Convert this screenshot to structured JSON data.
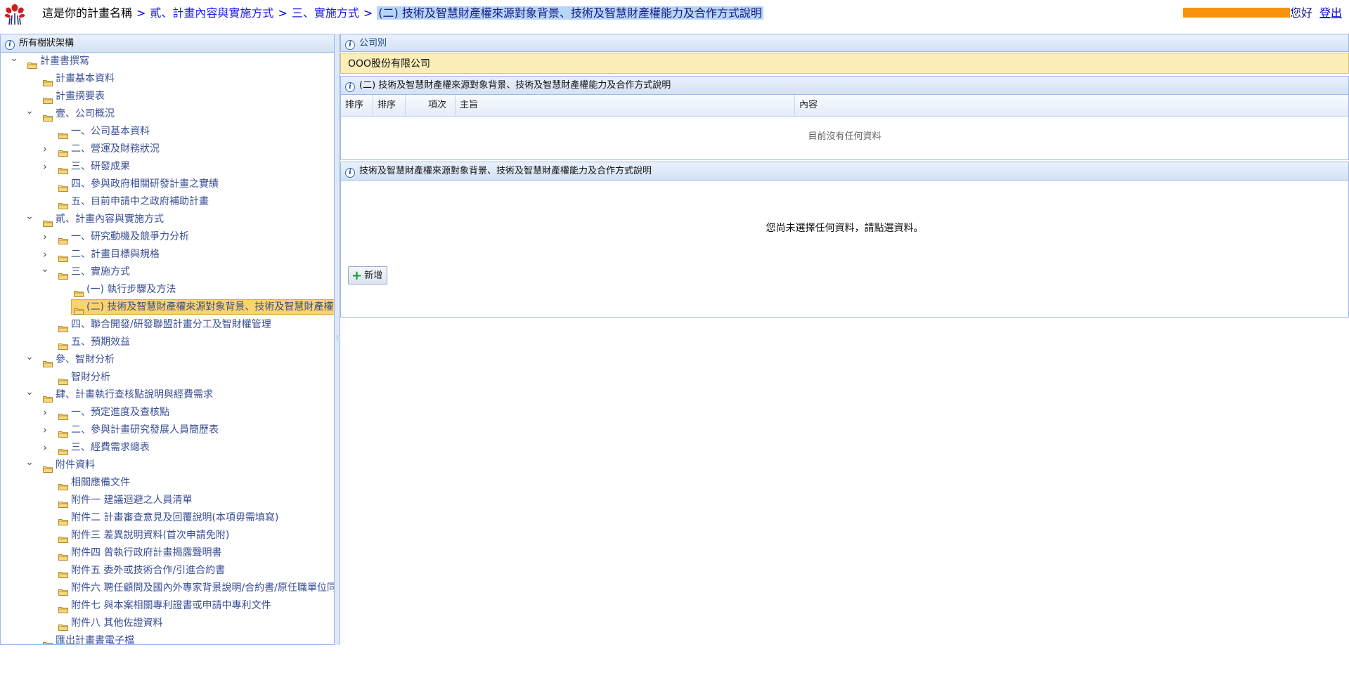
{
  "header": {
    "plan_name": "這是你的計畫名稱",
    "separator": ">",
    "crumbs": [
      "貳、計畫內容與實施方式",
      "三、實施方式",
      "(二) 技術及智慧財產權來源對象背景、技術及智慧財產權能力及合作方式說明"
    ],
    "greeting": "您好",
    "logout": "登出"
  },
  "tree": {
    "title": "所有樹狀架構",
    "items": [
      {
        "label": "計畫書撰寫",
        "level": 0,
        "toggle": "expanded"
      },
      {
        "label": "計畫基本資料",
        "level": 1,
        "toggle": "none"
      },
      {
        "label": "計畫摘要表",
        "level": 1,
        "toggle": "none"
      },
      {
        "label": "壹、公司概況",
        "level": 1,
        "toggle": "expanded"
      },
      {
        "label": "一、公司基本資料",
        "level": 2,
        "toggle": "none"
      },
      {
        "label": "二、營運及財務狀況",
        "level": 2,
        "toggle": "collapsed"
      },
      {
        "label": "三、研發成果",
        "level": 2,
        "toggle": "collapsed"
      },
      {
        "label": "四、參與政府相關研發計畫之實績",
        "level": 2,
        "toggle": "none"
      },
      {
        "label": "五、目前申請中之政府補助計畫",
        "level": 2,
        "toggle": "none"
      },
      {
        "label": "貳、計畫內容與實施方式",
        "level": 1,
        "toggle": "expanded"
      },
      {
        "label": "一、研究動機及競爭力分析",
        "level": 2,
        "toggle": "collapsed"
      },
      {
        "label": "二、計畫目標與規格",
        "level": 2,
        "toggle": "collapsed"
      },
      {
        "label": "三、實施方式",
        "level": 2,
        "toggle": "expanded"
      },
      {
        "label": "(一) 執行步驟及方法",
        "level": 3,
        "toggle": "none"
      },
      {
        "label": "(二) 技術及智慧財產權來源對象背景、技術及智慧財產權能力及合作方式說明",
        "level": 3,
        "toggle": "none",
        "selected": true
      },
      {
        "label": "四、聯合開發/研發聯盟計畫分工及智財權管理",
        "level": 2,
        "toggle": "none"
      },
      {
        "label": "五、預期效益",
        "level": 2,
        "toggle": "none"
      },
      {
        "label": "參、智財分析",
        "level": 1,
        "toggle": "expanded"
      },
      {
        "label": "智財分析",
        "level": 2,
        "toggle": "none"
      },
      {
        "label": "肆、計畫執行查核點說明與經費需求",
        "level": 1,
        "toggle": "expanded"
      },
      {
        "label": "一、預定進度及查核點",
        "level": 2,
        "toggle": "collapsed"
      },
      {
        "label": "二、參與計畫研究發展人員簡歷表",
        "level": 2,
        "toggle": "collapsed"
      },
      {
        "label": "三、經費需求總表",
        "level": 2,
        "toggle": "collapsed"
      },
      {
        "label": "附件資料",
        "level": 1,
        "toggle": "expanded"
      },
      {
        "label": "相關應備文件",
        "level": 2,
        "toggle": "none"
      },
      {
        "label": "附件一 建議迴避之人員清單",
        "level": 2,
        "toggle": "none"
      },
      {
        "label": "附件二 計畫審查意見及回覆說明(本項毋需填寫)",
        "level": 2,
        "toggle": "none"
      },
      {
        "label": "附件三 差異說明資料(首次申請免附)",
        "level": 2,
        "toggle": "none"
      },
      {
        "label": "附件四 曾執行政府計畫揭露聲明書",
        "level": 2,
        "toggle": "none"
      },
      {
        "label": "附件五 委外或技術合作/引進合約書",
        "level": 2,
        "toggle": "none"
      },
      {
        "label": "附件六 聘任顧問及國內外專家背景說明/合約書/原任職單位同意函",
        "level": 2,
        "toggle": "none"
      },
      {
        "label": "附件七 與本案相關專利證書或申請中專利文件",
        "level": 2,
        "toggle": "none"
      },
      {
        "label": "附件八 其他佐證資料",
        "level": 2,
        "toggle": "none"
      },
      {
        "label": "匯出計畫書電子檔",
        "level": 1,
        "toggle": "none"
      }
    ]
  },
  "company": {
    "title": "公司別",
    "value": "OOO股份有限公司"
  },
  "grid": {
    "title": "(二) 技術及智慧財產權來源對象背景、技術及智慧財產權能力及合作方式說明",
    "columns": [
      "排序",
      "排序",
      "項次",
      "主旨",
      "內容"
    ],
    "empty_message": "目前沒有任何資料"
  },
  "detail": {
    "title": "技術及智慧財產權來源對象背景、技術及智慧財產權能力及合作方式說明",
    "message": "您尚未選擇任何資料，請點選資料。",
    "add_label": "新增"
  },
  "colors": {
    "header_bg": "#d4e2f4",
    "border": "#99bbe8",
    "selected": "#fbd36c",
    "company_bg": "#fbeeb8",
    "redaction": "#f7930e"
  }
}
